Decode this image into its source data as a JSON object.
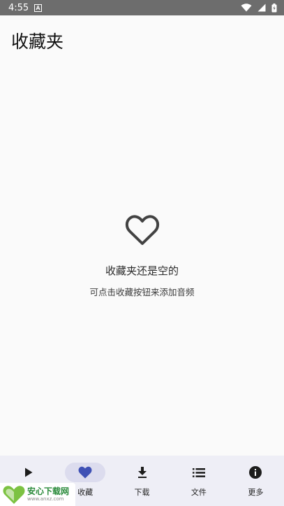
{
  "status_bar": {
    "time": "4:55"
  },
  "header": {
    "title": "收藏夹"
  },
  "empty_state": {
    "title": "收藏夹还是空的",
    "subtitle": "可点击收藏按钮来添加音频"
  },
  "bottom_nav": {
    "items": [
      {
        "label": "",
        "icon": "play-icon"
      },
      {
        "label": "收藏",
        "icon": "heart-icon",
        "active": true
      },
      {
        "label": "下载",
        "icon": "download-icon"
      },
      {
        "label": "文件",
        "icon": "list-icon"
      },
      {
        "label": "更多",
        "icon": "info-icon"
      }
    ]
  },
  "watermark": {
    "name": "安心下载网",
    "url": "www.anxz.com"
  },
  "colors": {
    "accent": "#3f51b5",
    "active_pill": "#dcdcee",
    "nav_background": "#eeeef6",
    "status_bar": "#6d6d6d"
  }
}
